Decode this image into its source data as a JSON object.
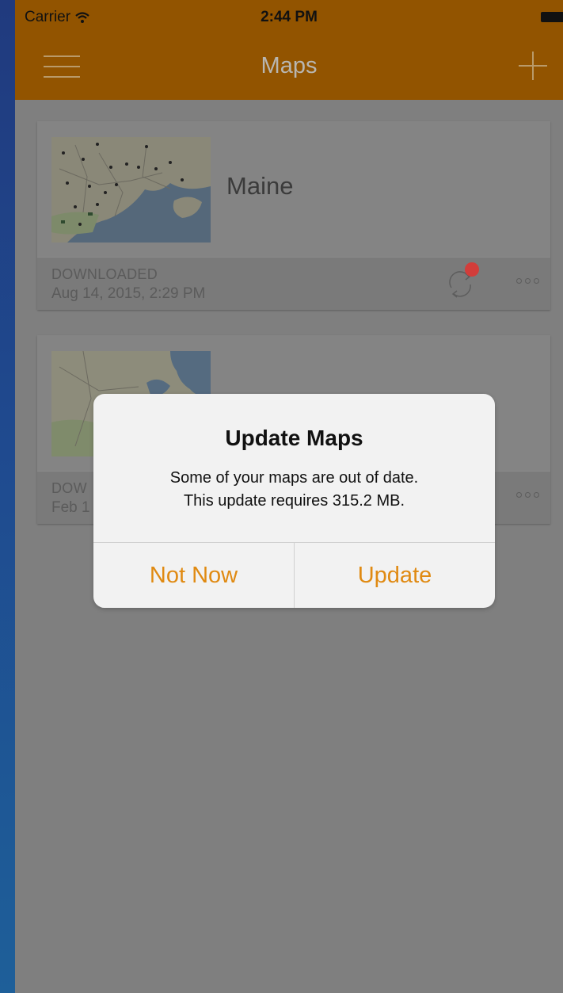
{
  "status_bar": {
    "carrier": "Carrier",
    "time": "2:44 PM"
  },
  "nav": {
    "title": "Maps",
    "menu_icon": "hamburger-menu-icon",
    "add_icon": "plus-icon"
  },
  "maps": [
    {
      "name": "Maine",
      "status": "DOWNLOADED",
      "date": "Aug 14, 2015, 2:29 PM",
      "has_update_badge": true
    },
    {
      "name": "",
      "status": "DOW",
      "date": "Feb 1",
      "has_update_badge": false
    }
  ],
  "alert": {
    "title": "Update Maps",
    "message_line1": "Some of your maps are out of date.",
    "message_line2": "This update requires 315.2 MB.",
    "cancel_label": "Not Now",
    "confirm_label": "Update"
  },
  "colors": {
    "nav_bar": "#925400",
    "accent": "#e08a12",
    "badge": "#e03a3a",
    "dim_background": "#7f7f7f"
  }
}
